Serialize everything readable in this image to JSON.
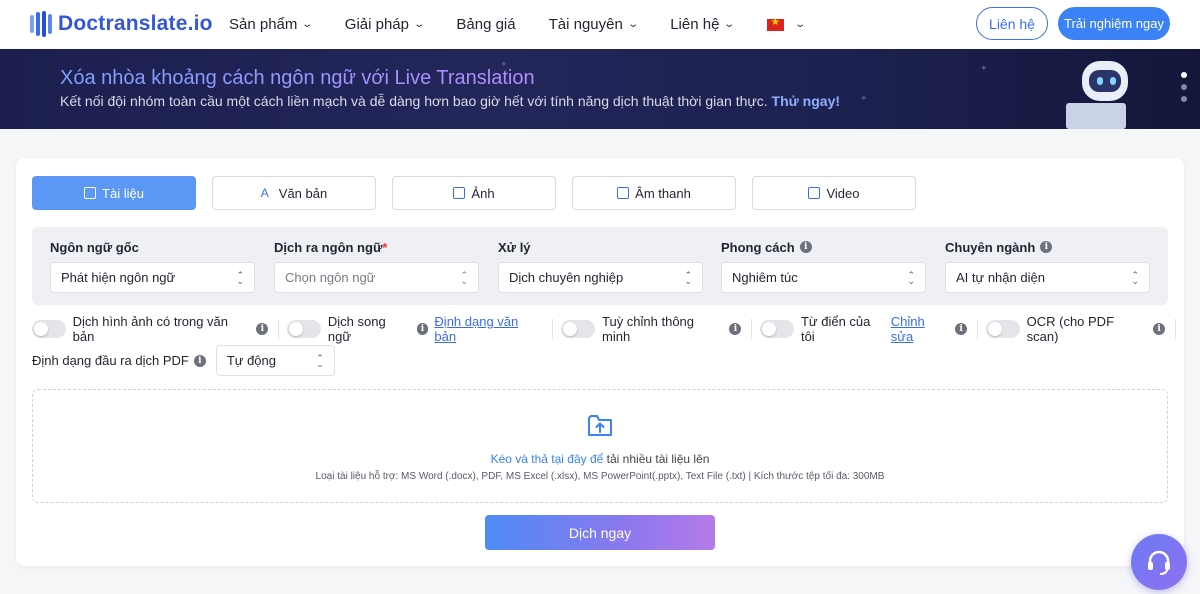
{
  "header": {
    "logo_text": "Doctranslate.io",
    "nav": [
      {
        "label": "Sản phẩm",
        "has_dropdown": true
      },
      {
        "label": "Giải pháp",
        "has_dropdown": true
      },
      {
        "label": "Bảng giá",
        "has_dropdown": false
      },
      {
        "label": "Tài nguyên",
        "has_dropdown": true
      },
      {
        "label": "Liên hệ",
        "has_dropdown": true
      }
    ],
    "language_flag": "vietnam-flag-icon",
    "contact_button": "Liên hệ",
    "try_button": "Trải nghiệm ngay",
    "accent_color": "#3b6cf0"
  },
  "banner": {
    "title": "Xóa nhòa khoảng cách ngôn ngữ với Live Translation",
    "subtitle": "Kết nối đội nhóm toàn cầu một cách liền mạch và dễ dàng hơn bao giờ hết với tính năng dịch thuật thời gian thực.",
    "cta": "Thử ngay!",
    "carousel_dots": 3,
    "active_dot": 1
  },
  "tabs": [
    {
      "label": "Tài liệu",
      "icon": "document-icon",
      "active": true
    },
    {
      "label": "Văn bản",
      "icon": "text-icon",
      "active": false
    },
    {
      "label": "Ảnh",
      "icon": "image-icon",
      "active": false
    },
    {
      "label": "Âm thanh",
      "icon": "audio-icon",
      "active": false
    },
    {
      "label": "Video",
      "icon": "video-icon",
      "active": false
    }
  ],
  "settings": {
    "source_language": {
      "label": "Ngôn ngữ gốc",
      "value": "Phát hiện ngôn ngữ"
    },
    "target_language": {
      "label": "Dịch ra ngôn ngữ",
      "required_mark": "*",
      "placeholder": "Chọn ngôn ngữ"
    },
    "processing": {
      "label": "Xử lý",
      "value": "Dịch chuyên nghiệp"
    },
    "style": {
      "label": "Phong cách",
      "value": "Nghiêm túc"
    },
    "domain": {
      "label": "Chuyên ngành",
      "value": "AI tự nhận diện"
    }
  },
  "toggles": {
    "translate_images": {
      "label": "Dịch hình ảnh có trong văn bản",
      "on": false
    },
    "bilingual": {
      "label": "Dịch song ngữ",
      "link": "Định dạng văn bản",
      "on": false
    },
    "smart_adjust": {
      "label": "Tuỳ chỉnh thông minh",
      "on": false
    },
    "my_dictionary": {
      "label": "Từ điển của tôi",
      "link": "Chỉnh sửa",
      "on": false
    },
    "ocr": {
      "label": "OCR (cho PDF scan)",
      "on": false
    }
  },
  "pdf_output": {
    "label": "Định dạng đầu ra dịch PDF",
    "value": "Tự động"
  },
  "dropzone": {
    "link_text": "Kéo và thả tại đây để",
    "text": "tải nhiều tài liệu lên",
    "supported": "Loại tài liệu hỗ trợ: MS Word (.docx), PDF, MS Excel (.xlsx), MS PowerPoint(.pptx), Text File (.txt) | Kích thước tệp tối đa: 300MB"
  },
  "submit_label": "Dịch ngay",
  "support_icon": "headset-icon"
}
